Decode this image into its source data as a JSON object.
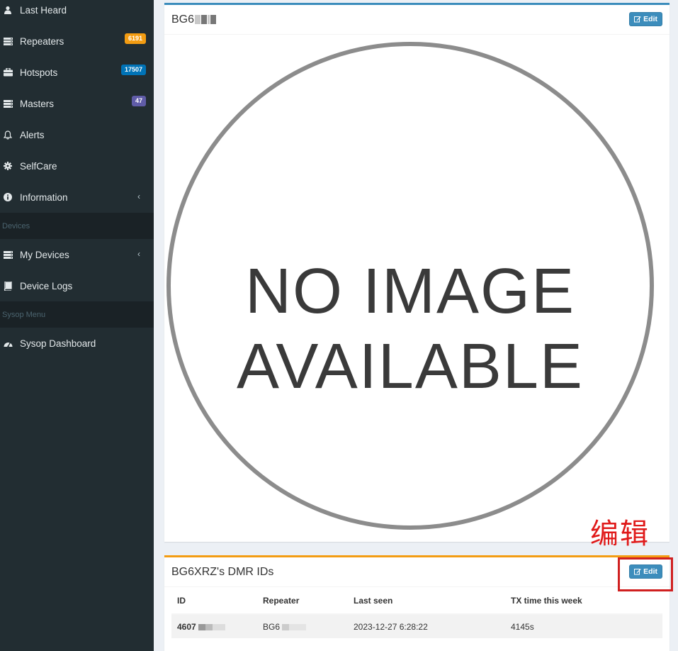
{
  "sidebar": {
    "items": [
      {
        "label": "Last Heard",
        "icon": "user-icon"
      },
      {
        "label": "Repeaters",
        "icon": "server-icon",
        "badge": "6191",
        "badge_color": "#f39c12"
      },
      {
        "label": "Hotspots",
        "icon": "briefcase-icon",
        "badge": "17507",
        "badge_color": "#0073b7"
      },
      {
        "label": "Masters",
        "icon": "server-icon",
        "badge": "47",
        "badge_color": "#605ca8"
      },
      {
        "label": "Alerts",
        "icon": "bell-icon"
      },
      {
        "label": "SelfCare",
        "icon": "gear-icon"
      },
      {
        "label": "Information",
        "icon": "info-circle-icon"
      }
    ],
    "section_devices": "Devices",
    "devices_items": [
      {
        "label": "My Devices",
        "icon": "server-icon"
      },
      {
        "label": "Device Logs",
        "icon": "book-icon"
      }
    ],
    "section_sysop": "Sysop Menu",
    "sysop_items": [
      {
        "label": "Sysop Dashboard",
        "icon": "dashboard-icon"
      }
    ]
  },
  "profile_box": {
    "title": "BG6",
    "edit_label": "Edit",
    "image_text_line1": "NO IMAGE",
    "image_text_line2": "AVAILABLE"
  },
  "dmr_box": {
    "title": "BG6XRZ's DMR IDs",
    "edit_label": "Edit",
    "columns": [
      "ID",
      "Repeater",
      "Last seen",
      "TX time this week"
    ],
    "rows": [
      {
        "id": "4607",
        "repeater": "BG6",
        "last_seen": "2023-12-27 6:28:22",
        "tx_time": "4145s"
      }
    ]
  },
  "annotation": {
    "text": "编辑",
    "color": "#e01a1a"
  }
}
